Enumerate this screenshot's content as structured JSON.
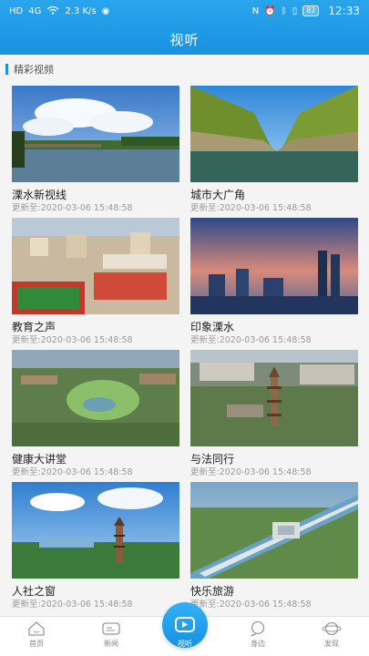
{
  "status": {
    "net": "HD",
    "signal": "4G",
    "speed": "2.3 K/s",
    "battery": "82",
    "time": "12:33"
  },
  "header": {
    "title": "视听"
  },
  "section": {
    "title": "精彩视频"
  },
  "videos": [
    {
      "title": "溧水新视线",
      "updated": "更新至:2020-03-06 15:48:58"
    },
    {
      "title": "城市大广角",
      "updated": "更新至:2020-03-06 15:48:58"
    },
    {
      "title": "教育之声",
      "updated": "更新至:2020-03-06 15:48:58"
    },
    {
      "title": "印象溧水",
      "updated": "更新至:2020-03-06 15:48:58"
    },
    {
      "title": "健康大讲堂",
      "updated": "更新至:2020-03-06 15:48:58"
    },
    {
      "title": "与法同行",
      "updated": "更新至:2020-03-06 15:48:58"
    },
    {
      "title": "人社之窗",
      "updated": "更新至:2020-03-06 15:48:58"
    },
    {
      "title": "快乐旅游",
      "updated": "更新至:2020-03-06 15:48:58"
    }
  ],
  "nav": {
    "home": "首页",
    "news": "新闻",
    "video": "视听",
    "nearby": "身边",
    "discover": "发现"
  }
}
